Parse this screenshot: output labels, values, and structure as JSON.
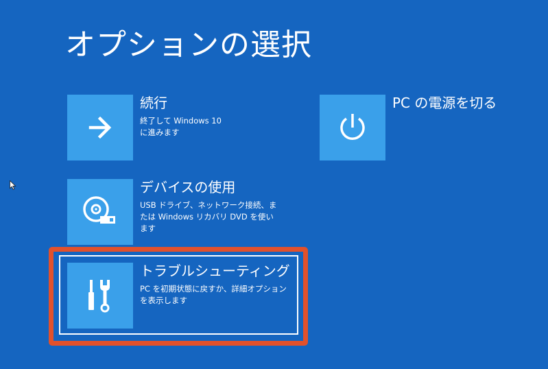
{
  "page": {
    "title": "オプションの選択"
  },
  "options": {
    "continue": {
      "title": "続行",
      "description": "終了して Windows 10 に進みます",
      "icon": "arrow-right-icon"
    },
    "use_device": {
      "title": "デバイスの使用",
      "description": "USB ドライブ、ネットワーク接続、または Windows リカバリ DVD を使います",
      "icon": "disc-drive-icon"
    },
    "troubleshoot": {
      "title": "トラブルシューティング",
      "description": "PC を初期状態に戻すか、詳細オプションを表示します",
      "icon": "tools-icon",
      "selected": true
    },
    "power_off": {
      "title": "PC の電源を切る",
      "icon": "power-icon"
    }
  },
  "colors": {
    "background": "#1565c0",
    "tile": "#3aa0ea",
    "text": "#ffffff",
    "highlight": "#e2512c"
  }
}
